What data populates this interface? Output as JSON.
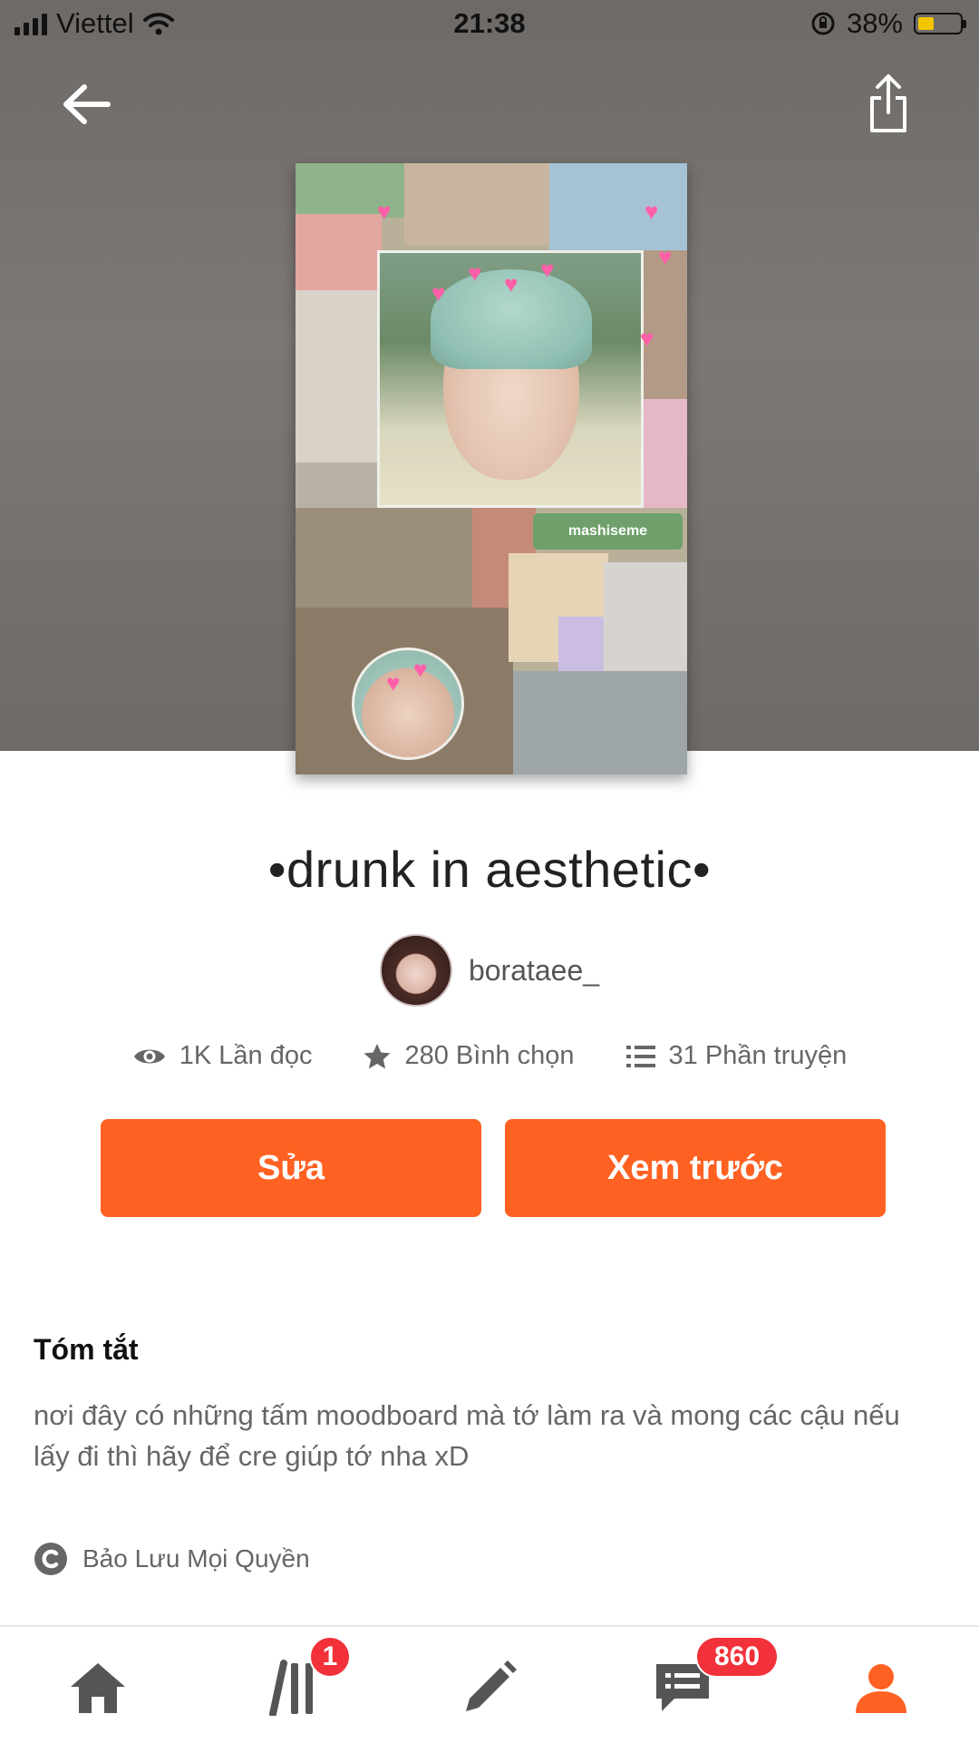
{
  "status_bar": {
    "carrier": "Viettel",
    "time": "21:38",
    "battery_percent": "38%",
    "battery_level": 0.38,
    "battery_fill_color": "#f3c500"
  },
  "header": {
    "back_icon": "arrow-left-icon",
    "share_icon": "share-icon"
  },
  "cover": {
    "sticker_text": "mashiseme"
  },
  "book": {
    "title": "•drunk in aesthetic•",
    "author": "borataee_",
    "stats": {
      "reads": "1K Lần đọc",
      "votes": "280 Bình chọn",
      "parts": "31 Phần truyện"
    }
  },
  "actions": {
    "edit_label": "Sửa",
    "preview_label": "Xem trước",
    "accent_color": "#ff6122"
  },
  "summary": {
    "heading": "Tóm tắt",
    "text": "nơi đây có những tấm moodboard mà tớ làm ra và mong các cậu nếu lấy đi thì hãy để cre giúp tớ nha xD",
    "copyright": "Bảo Lưu Mọi Quyền"
  },
  "bottom_nav": {
    "items": [
      {
        "name": "home",
        "icon": "home-icon"
      },
      {
        "name": "library",
        "icon": "library-icon",
        "badge": "1"
      },
      {
        "name": "write",
        "icon": "pencil-icon"
      },
      {
        "name": "messages",
        "icon": "chat-icon",
        "badge": "860"
      },
      {
        "name": "profile",
        "icon": "person-icon",
        "active_color": "#ff6122"
      }
    ]
  }
}
